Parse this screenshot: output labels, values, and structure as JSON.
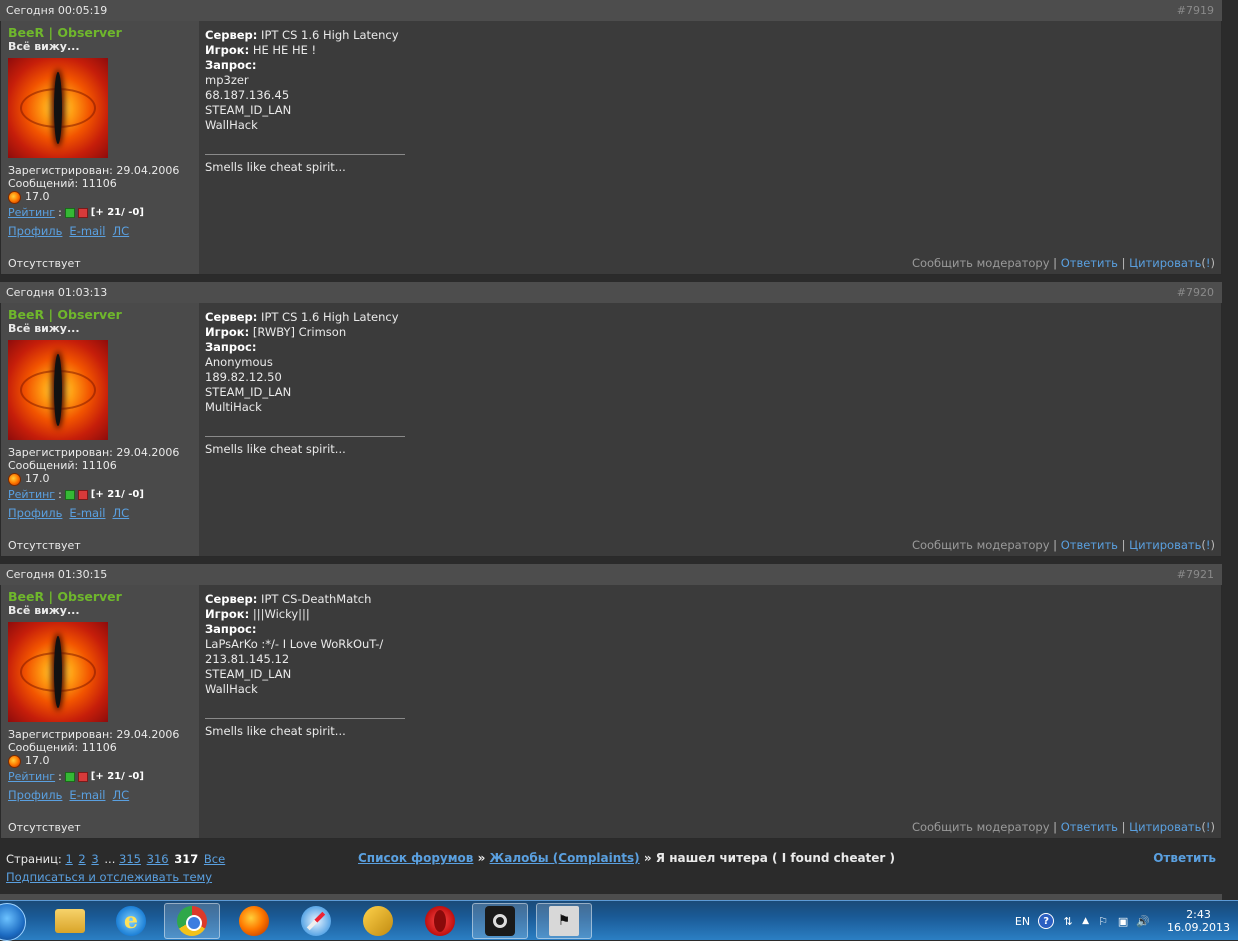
{
  "posts": [
    {
      "date": "Сегодня 00:05:19",
      "num": "#7919",
      "user": {
        "name": "BeeR | Observer",
        "title": "Всё вижу...",
        "registered": "Зарегистрирован: 29.04.2006",
        "messages": "Сообщений: 11106",
        "version": "17.0",
        "rating_link": "Рейтинг",
        "rating_value": "[+ 21/ -0]",
        "profile": "Профиль",
        "email": "E-mail",
        "pm": "ЛС",
        "status": "Отсутствует"
      },
      "server_label": "Сервер:",
      "server": "IPT CS 1.6 High Latency",
      "player_label": "Игрок:",
      "player": "HE HE HE !",
      "request_label": "Запрос:",
      "lines": [
        "mp3zer",
        "68.187.136.45",
        "STEAM_ID_LAN",
        "WallHack"
      ],
      "signature": "Smells like cheat spirit..."
    },
    {
      "date": "Сегодня 01:03:13",
      "num": "#7920",
      "user": {
        "name": "BeeR | Observer",
        "title": "Всё вижу...",
        "registered": "Зарегистрирован: 29.04.2006",
        "messages": "Сообщений: 11106",
        "version": "17.0",
        "rating_link": "Рейтинг",
        "rating_value": "[+ 21/ -0]",
        "profile": "Профиль",
        "email": "E-mail",
        "pm": "ЛС",
        "status": "Отсутствует"
      },
      "server_label": "Сервер:",
      "server": "IPT CS 1.6 High Latency",
      "player_label": "Игрок:",
      "player": "[RWBY] Crimson",
      "request_label": "Запрос:",
      "lines": [
        "Anonymous",
        "189.82.12.50",
        "STEAM_ID_LAN",
        "MultiHack"
      ],
      "signature": "Smells like cheat spirit..."
    },
    {
      "date": "Сегодня 01:30:15",
      "num": "#7921",
      "user": {
        "name": "BeeR | Observer",
        "title": "Всё вижу...",
        "registered": "Зарегистрирован: 29.04.2006",
        "messages": "Сообщений: 11106",
        "version": "17.0",
        "rating_link": "Рейтинг",
        "rating_value": "[+ 21/ -0]",
        "profile": "Профиль",
        "email": "E-mail",
        "pm": "ЛС",
        "status": "Отсутствует"
      },
      "server_label": "Сервер:",
      "server": "IPT CS-DeathMatch",
      "player_label": "Игрок:",
      "player": "|||Wicky|||",
      "request_label": "Запрос:",
      "lines": [
        "LaPsArKo :*/- I Love WoRkOuT-/",
        "213.81.145.12",
        "STEAM_ID_LAN",
        "WallHack"
      ],
      "signature": "Smells like cheat spirit..."
    }
  ],
  "actions": {
    "report": "Сообщить модератору",
    "sep": "|",
    "reply": "Ответить",
    "quote": "Цитировать",
    "excl_open": "(",
    "excl": "!",
    "excl_close": ")"
  },
  "footer": {
    "pages_label": "Страниц:",
    "pages": [
      "1",
      "2",
      "3"
    ],
    "ellipsis": "...",
    "pages_tail": [
      "315",
      "316"
    ],
    "current": "317",
    "all": "Все",
    "subscribe": "Подписаться и отслеживать тему",
    "crumb1": "Список форумов",
    "crumb_sep": "»",
    "crumb2": "Жалобы (Complaints)",
    "crumb3": "Я нашел читера ( I found cheater )",
    "reply": "Ответить"
  },
  "taskbar": {
    "lang": "EN",
    "time": "2:43",
    "date": "16.09.2013",
    "ie_glyph": "e",
    "cs_glyph": "⚑",
    "help_glyph": "?",
    "tri_glyph": "▲",
    "net_glyph": "⇅",
    "flag_glyph": "⚐",
    "screen_glyph": "▣",
    "vol_glyph": "🔊"
  }
}
